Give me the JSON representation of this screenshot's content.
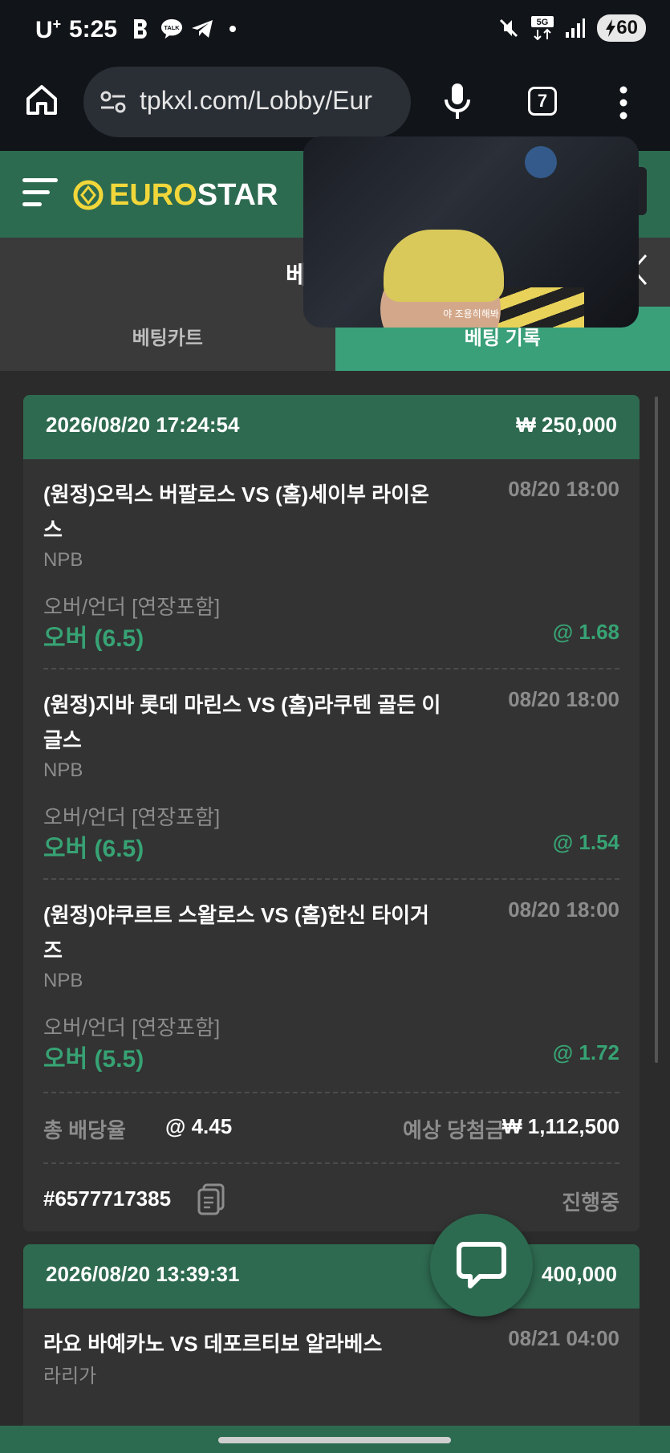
{
  "status_bar": {
    "carrier": "U",
    "carrier_sup": "+",
    "time": "5:25",
    "battery": "60",
    "network": "5G"
  },
  "browser": {
    "url": "tpkxl.com/Lobby/Eur",
    "tab_count": "7"
  },
  "site": {
    "logo_euro": "EURO",
    "logo_star": "STAR"
  },
  "title_bar": {
    "title": "베"
  },
  "tabs": [
    {
      "label": "베팅카트"
    },
    {
      "label": "베팅 기록"
    }
  ],
  "video": {
    "subtitle": "야 조용히해봐"
  },
  "colors": {
    "brand_green": "#2d6b51",
    "tab_active": "#3aa07a",
    "accent_green": "#37a374",
    "logo_yellow": "#f2d73a"
  },
  "bet_slips": [
    {
      "datetime": "2026/08/20 17:24:54",
      "amount": "₩ 250,000",
      "bets": [
        {
          "match": "(원정)오릭스 버팔로스 VS (홈)세이부 라이온스",
          "time": "08/20 18:00",
          "league": "NPB",
          "market": "오버/언더 [연장포함]",
          "pick": "오버 (6.5)",
          "odds": "@ 1.68"
        },
        {
          "match": "(원정)지바 롯데 마린스 VS (홈)라쿠텐 골든 이글스",
          "time": "08/20 18:00",
          "league": "NPB",
          "market": "오버/언더 [연장포함]",
          "pick": "오버 (6.5)",
          "odds": "@ 1.54"
        },
        {
          "match": "(원정)야쿠르트 스왈로스 VS (홈)한신 타이거즈",
          "time": "08/20 18:00",
          "league": "NPB",
          "market": "오버/언더 [연장포함]",
          "pick": "오버 (5.5)",
          "odds": "@ 1.72"
        }
      ],
      "total_odds_label": "총 배당율",
      "total_odds": "@ 4.45",
      "payout_label": "예상 당첨금",
      "payout": "₩ 1,112,500",
      "ticket_id": "#6577717385",
      "status": "진행중"
    },
    {
      "datetime": "2026/08/20 13:39:31",
      "amount": "400,000",
      "bets": [
        {
          "match": "라요 바예카노 VS 데포르티보 알라베스",
          "time": "08/21 04:00",
          "league": "라리가"
        }
      ]
    }
  ]
}
